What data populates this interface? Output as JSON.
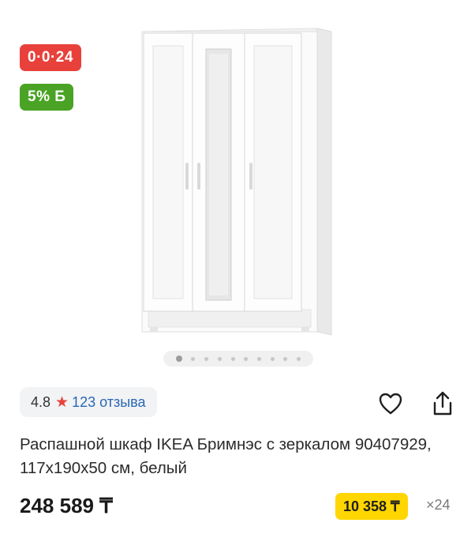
{
  "badges": {
    "installment": "0·0·24",
    "bonus": "5% Б"
  },
  "gallery": {
    "image_alt": "Распашной шкаф IKEA Бримнэс с зеркалом",
    "dots_count": 10,
    "active_index": 0
  },
  "rating": {
    "value": "4.8",
    "star": "★",
    "reviews_label": "123 отзыва"
  },
  "actions": {
    "favorite_icon": "heart-icon",
    "share_icon": "share-icon"
  },
  "product": {
    "title": "Распашной шкаф IKEA Бримнэс с зеркалом 90407929, 117x190x50 см, белый",
    "price": "248 589 ₸",
    "monthly_payment": "10 358 ₸",
    "months": "×24"
  },
  "colors": {
    "installment_badge": "#e8413b",
    "bonus_badge": "#4aa325",
    "monthly_badge": "#ffd600",
    "link": "#2a68b3",
    "star": "#e8413b"
  }
}
